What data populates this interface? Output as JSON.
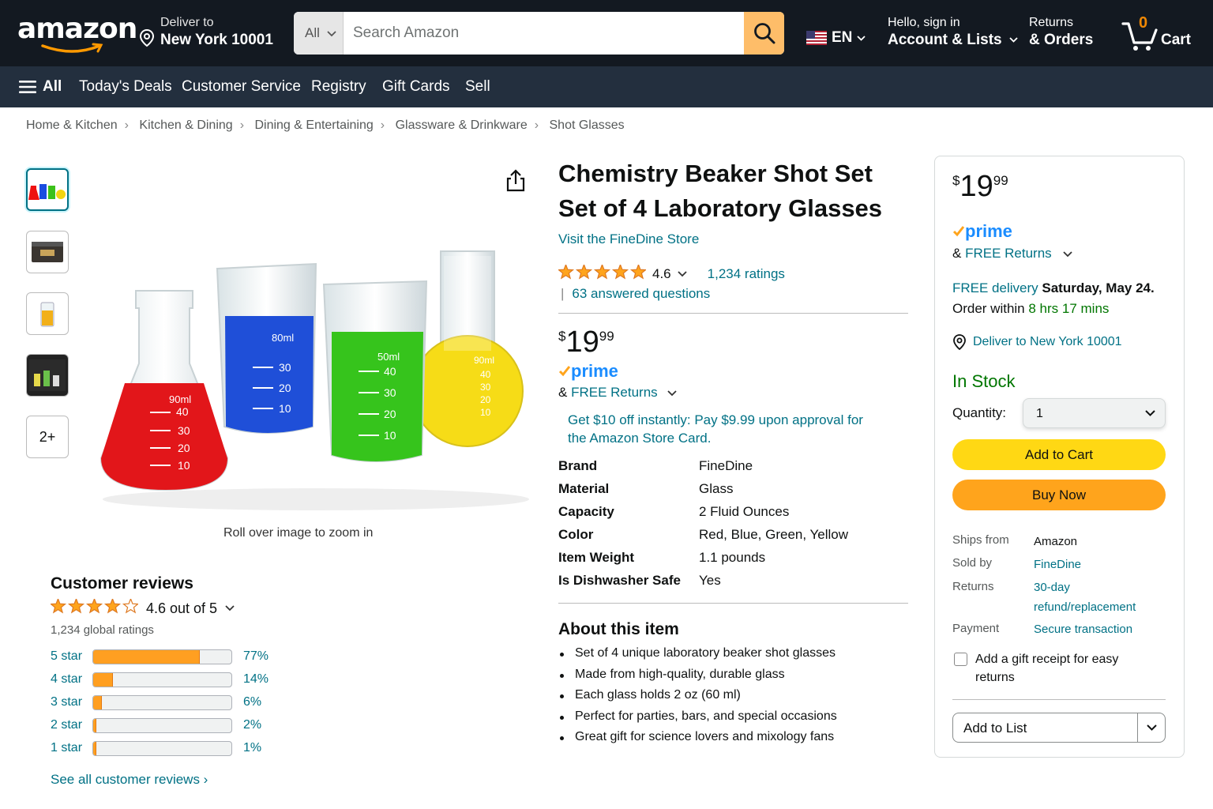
{
  "header": {
    "logo_text": "amazon",
    "deliver_label": "Deliver to",
    "deliver_location": "New York 10001",
    "search_category": "All",
    "search_placeholder": "Search Amazon",
    "language": "EN",
    "account_greeting": "Hello, sign in",
    "account_label": "Account & Lists",
    "returns_label": "Returns",
    "orders_label": "& Orders",
    "cart_count": "0",
    "cart_label": "Cart"
  },
  "nav": {
    "all": "All",
    "items": [
      "Today's Deals",
      "Customer Service",
      "Registry",
      "Gift Cards",
      "Sell"
    ]
  },
  "breadcrumb": [
    "Home & Kitchen",
    "Kitchen & Dining",
    "Dining & Entertaining",
    "Glassware & Drinkware",
    "Shot Glasses"
  ],
  "gallery": {
    "more_label": "2+",
    "zoom_hint": "Roll over image to zoom in",
    "beaker_marks": {
      "red": [
        "90ml",
        "40",
        "30",
        "20",
        "10"
      ],
      "blue": [
        "80ml",
        "30",
        "20",
        "10"
      ],
      "green": [
        "50ml",
        "40",
        "30",
        "20",
        "10"
      ],
      "yellow": [
        "90ml",
        "40",
        "30",
        "20",
        "10"
      ]
    }
  },
  "reviews": {
    "title": "Customer reviews",
    "summary": "4.6 out of 5",
    "global_ratings": "1,234 global ratings",
    "histogram": [
      {
        "label": "5 star",
        "pct": "77%",
        "value": 77
      },
      {
        "label": "4 star",
        "pct": "14%",
        "value": 14
      },
      {
        "label": "3 star",
        "pct": "6%",
        "value": 6
      },
      {
        "label": "2 star",
        "pct": "2%",
        "value": 2
      },
      {
        "label": "1 star",
        "pct": "1%",
        "value": 1
      }
    ],
    "see_all": "See all customer reviews ›"
  },
  "product": {
    "title_line1": "Chemistry Beaker Shot Set",
    "title_line2": "Set of 4 Laboratory Glasses",
    "store_link": "Visit the FineDine Store",
    "rating": "4.6",
    "ratings_count": "1,234 ratings",
    "answered_questions": "63 answered questions",
    "price_symbol": "$",
    "price_whole": "19",
    "price_fraction": "99",
    "prime": "prime",
    "free_returns_prefix": "& ",
    "free_returns": "FREE Returns",
    "promo": "Get $10 off instantly: Pay $9.99 upon approval for the Amazon Store Card.",
    "specs": [
      {
        "key": "Brand",
        "value": "FineDine"
      },
      {
        "key": "Material",
        "value": "Glass"
      },
      {
        "key": "Capacity",
        "value": "2 Fluid Ounces"
      },
      {
        "key": "Color",
        "value": "Red, Blue, Green, Yellow"
      },
      {
        "key": "Item Weight",
        "value": "1.1 pounds"
      },
      {
        "key": "Is Dishwasher Safe",
        "value": "Yes"
      }
    ],
    "about_title": "About this item",
    "about": [
      "Set of 4 unique laboratory beaker shot glasses",
      "Made from high-quality, durable glass",
      "Each glass holds 2 oz (60 ml)",
      "Perfect for parties, bars, and special occasions",
      "Great gift for science lovers and mixology fans"
    ]
  },
  "buybox": {
    "price_symbol": "$",
    "price_whole": "19",
    "price_fraction": "99",
    "prime": "prime",
    "free_returns_prefix": "& ",
    "free_returns": "FREE Returns",
    "free_delivery": "FREE delivery",
    "delivery_date": "Saturday, May 24.",
    "order_within_prefix": "Order within ",
    "order_within": "8 hrs 17 mins",
    "deliver_to": "Deliver to New York 10001",
    "stock": "In Stock",
    "quantity_label": "Quantity:",
    "quantity_value": "1",
    "add_to_cart": "Add to Cart",
    "buy_now": "Buy Now",
    "ships_from_label": "Ships from",
    "ships_from": "Amazon",
    "sold_by_label": "Sold by",
    "sold_by": "FineDine",
    "returns_label": "Returns",
    "returns_line1": "30-day",
    "returns_line2": "refund/replacement",
    "payment_label": "Payment",
    "payment": "Secure transaction",
    "gift_receipt": "Add a gift receipt for easy returns",
    "add_to_list": "Add to List"
  },
  "colors": {
    "header_bg": "#131921",
    "nav_bg": "#232f3e",
    "link": "#007185",
    "star": "#ffa41c",
    "add_to_cart": "#ffd814",
    "buy_now": "#ffa41c",
    "in_stock": "#007600",
    "prime_blue": "#1a8cff"
  }
}
